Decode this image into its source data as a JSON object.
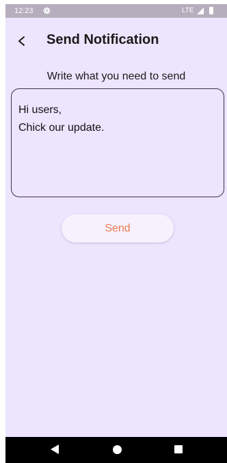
{
  "status_bar": {
    "time": "12:23",
    "network": "LTE",
    "icons": [
      "settings-gear-icon",
      "signal-icon",
      "battery-icon"
    ]
  },
  "app_bar": {
    "back_icon": "chevron-left-icon",
    "title": "Send Notification"
  },
  "form": {
    "prompt": "Write what you need to send",
    "message": "Hi users,\nChick our update.",
    "send_label": "Send"
  },
  "nav_bar": {
    "icons": [
      "nav-back-icon",
      "nav-home-icon",
      "nav-recents-icon"
    ]
  },
  "colors": {
    "background": "#ede4fe",
    "status_bar": "#b6aebd",
    "accent": "#f07a50",
    "button_bg": "#f6f1fc"
  }
}
